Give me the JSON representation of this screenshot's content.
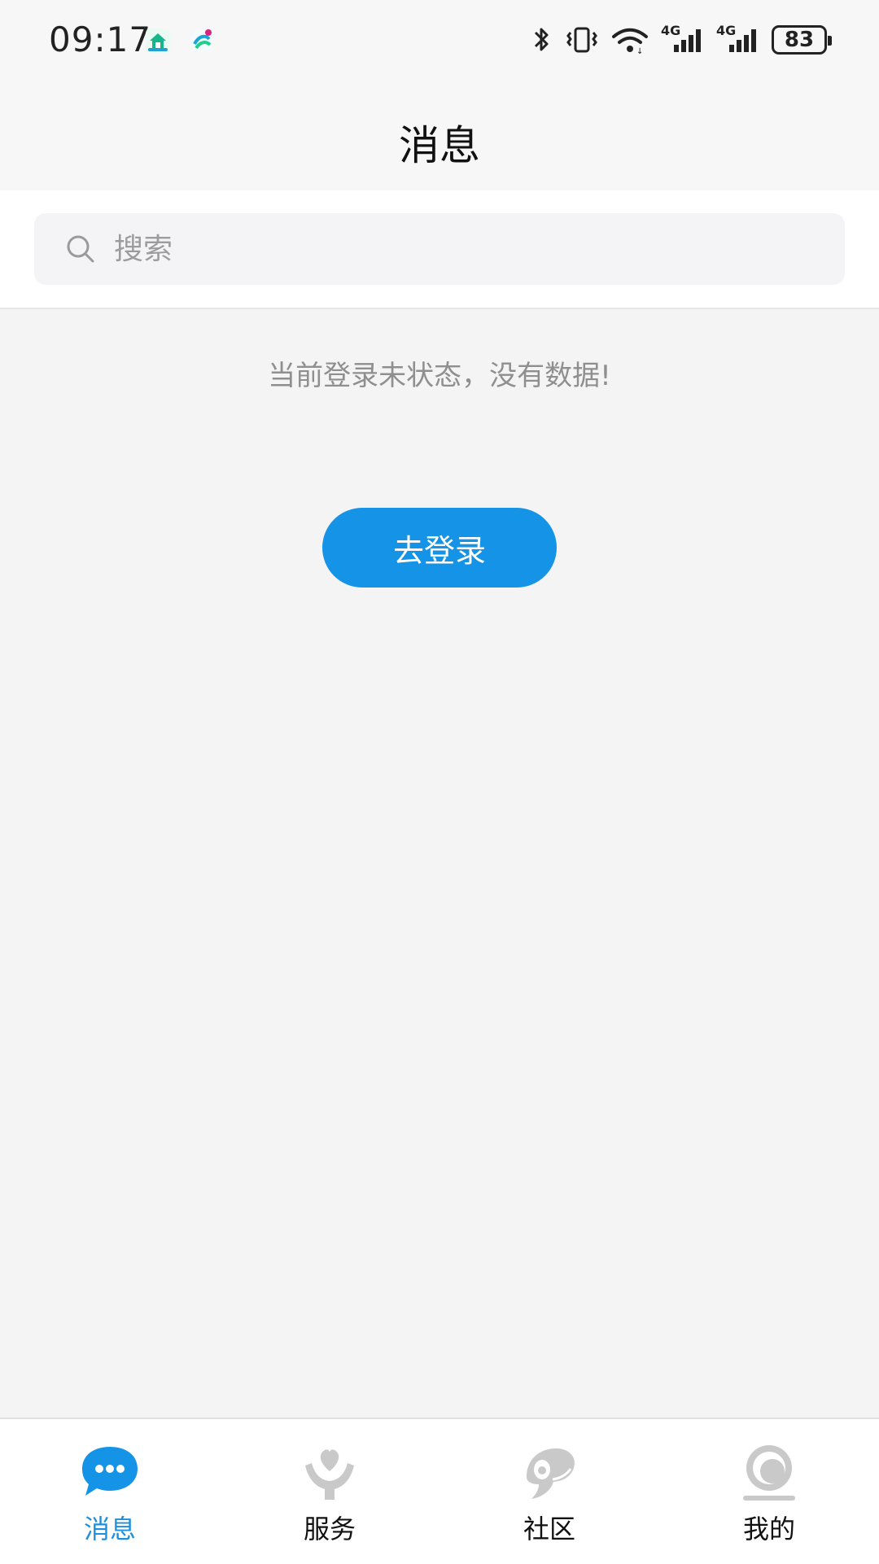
{
  "status_bar": {
    "time": "09:17",
    "battery": "83",
    "network": "4G",
    "icons": [
      "home-app-icon",
      "app-logo-icon",
      "bluetooth-icon",
      "vibrate-icon",
      "wifi-icon",
      "signal-icon",
      "battery-icon"
    ]
  },
  "header": {
    "title": "消息"
  },
  "search": {
    "placeholder": "搜索"
  },
  "empty_state": {
    "message": "当前登录未状态，没有数据!"
  },
  "login_button": {
    "label": "去登录"
  },
  "colors": {
    "accent": "#1593e6",
    "active_tab": "#1d8fdc",
    "inactive_icon": "#c9c9c9"
  },
  "tabs": [
    {
      "label": "消息",
      "icon": "chat-bubble-icon",
      "active": true
    },
    {
      "label": "服务",
      "icon": "heart-hands-icon",
      "active": false
    },
    {
      "label": "社区",
      "icon": "chameleon-icon",
      "active": false
    },
    {
      "label": "我的",
      "icon": "profile-circle-icon",
      "active": false
    }
  ]
}
